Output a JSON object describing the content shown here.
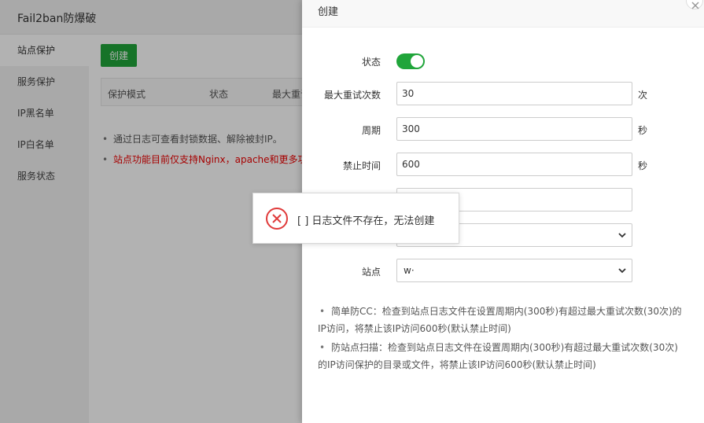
{
  "app": {
    "title": "Fail2ban防爆破"
  },
  "sidebar": {
    "items": [
      {
        "label": "站点保护"
      },
      {
        "label": "服务保护"
      },
      {
        "label": "IP黑名单"
      },
      {
        "label": "IP白名单"
      },
      {
        "label": "服务状态"
      }
    ]
  },
  "main": {
    "create_label": "创建",
    "table_headers": [
      "保护模式",
      "状态",
      "最大重试"
    ],
    "tips": [
      "通过日志可查看封锁数据、解除被封IP。",
      "站点功能目前仅支持Nginx，apache和更多功"
    ]
  },
  "modal": {
    "title": "创建",
    "fields": {
      "status_label": "状态",
      "status_on": true,
      "max_retry_label": "最大重试次数",
      "max_retry_value": "30",
      "max_retry_unit": "次",
      "period_label": "周期",
      "period_value": "300",
      "period_unit": "秒",
      "ban_time_label": "禁止时间",
      "ban_time_value": "600",
      "ban_time_unit": "秒",
      "blank_value": "",
      "mode_value": "",
      "site_label": "站点",
      "site_value": "w·"
    },
    "tips": [
      {
        "line1": "简单防CC：检查到站点日志文件在设置周期内(300秒)有超过最大重试次数(30次)的",
        "line2": "IP访问，将禁止该IP访问600秒(默认禁止时间)"
      },
      {
        "line1": "防站点扫描：检查到站点日志文件在设置周期内(300秒)有超过最大重试次数(30次)",
        "line2": "的IP访问保护的目录或文件，将禁止该IP访问600秒(默认禁止时间)"
      }
    ]
  },
  "message": {
    "text": "[ ] 日志文件不存在，无法创建",
    "icon": "error-circle-icon"
  },
  "colors": {
    "accent": "#20a53a",
    "error": "#e03a3a",
    "warning_text": "#e00000"
  }
}
